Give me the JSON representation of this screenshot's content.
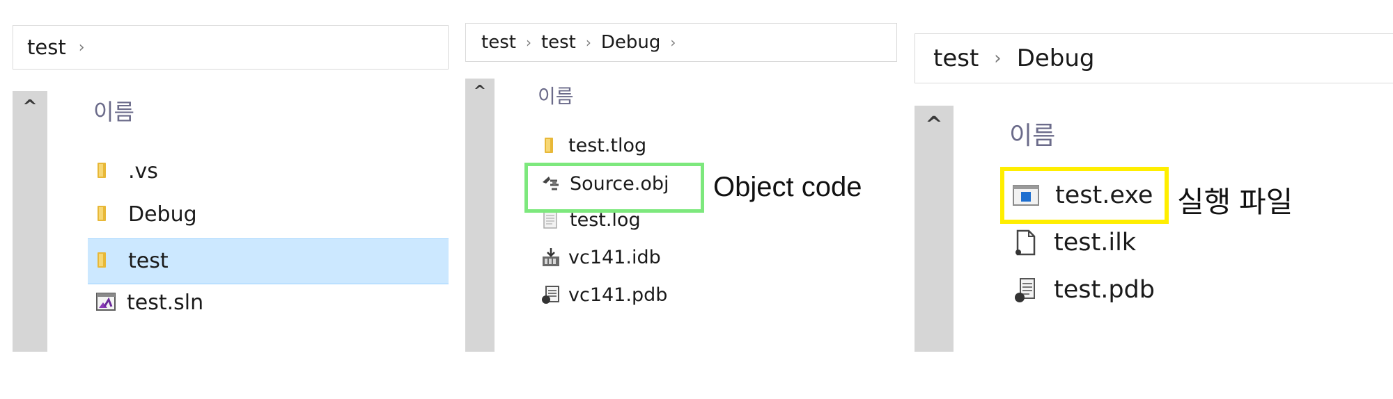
{
  "panel1": {
    "breadcrumb": [
      "test"
    ],
    "column_header": "이름",
    "items": [
      {
        "name": ".vs",
        "icon": "folder-icon"
      },
      {
        "name": "Debug",
        "icon": "folder-icon"
      },
      {
        "name": "test",
        "icon": "folder-icon",
        "selected": true
      },
      {
        "name": "test.sln",
        "icon": "visual-studio-solution-icon"
      }
    ]
  },
  "panel2": {
    "breadcrumb": [
      "test",
      "test",
      "Debug"
    ],
    "column_header": "이름",
    "items": [
      {
        "name": "test.tlog",
        "icon": "folder-icon"
      },
      {
        "name": "Source.obj",
        "icon": "object-file-icon"
      },
      {
        "name": "test.log",
        "icon": "text-file-icon"
      },
      {
        "name": "vc141.idb",
        "icon": "idb-file-icon"
      },
      {
        "name": "vc141.pdb",
        "icon": "pdb-file-icon"
      }
    ],
    "annotation": "Object code",
    "highlight_color": "#7de87d"
  },
  "panel3": {
    "breadcrumb": [
      "test",
      "Debug"
    ],
    "column_header": "이름",
    "items": [
      {
        "name": "test.exe",
        "icon": "executable-icon"
      },
      {
        "name": "test.ilk",
        "icon": "ilk-file-icon"
      },
      {
        "name": "test.pdb",
        "icon": "pdb-file-icon"
      }
    ],
    "annotation": "실행 파일",
    "highlight_color": "#ffee00"
  },
  "colors": {
    "selection": "#cce8ff",
    "folder": "#e8b838",
    "scrollbar": "#d6d6d6"
  }
}
